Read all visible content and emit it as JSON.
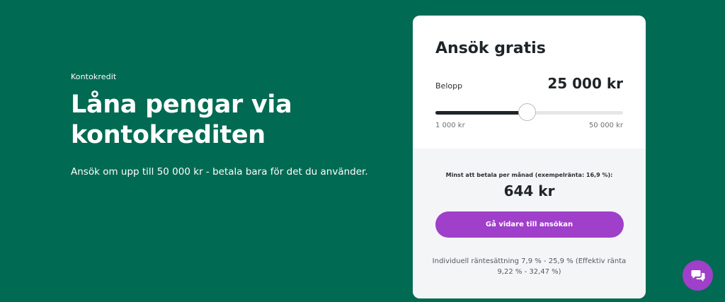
{
  "hero": {
    "eyebrow": "Kontokredit",
    "headline_line1": "Låna pengar via",
    "headline_line2": "kontokrediten",
    "subtitle": "Ansök om upp till 50 000 kr - betala bara för det du använder."
  },
  "card": {
    "title": "Ansök gratis",
    "amount_label": "Belopp",
    "amount_value": "25 000 kr",
    "slider": {
      "min_label": "1 000 kr",
      "max_label": "50 000 kr",
      "min": 1000,
      "max": 50000,
      "value": 25000
    },
    "monthly_label": "Minst att betala per månad (exempelränta: 16,9 %):",
    "monthly_value": "644 kr",
    "cta_label": "Gå vidare till ansökan",
    "disclaimer": "Individuell räntesättning 7,9 % - 25,9 % (Effektiv ränta 9,22 % - 32,47 %)"
  },
  "chat": {
    "icon": "chat-bubbles-icon"
  },
  "colors": {
    "background": "#016a52",
    "accent": "#a03fc9",
    "text_dark": "#1f2428"
  }
}
